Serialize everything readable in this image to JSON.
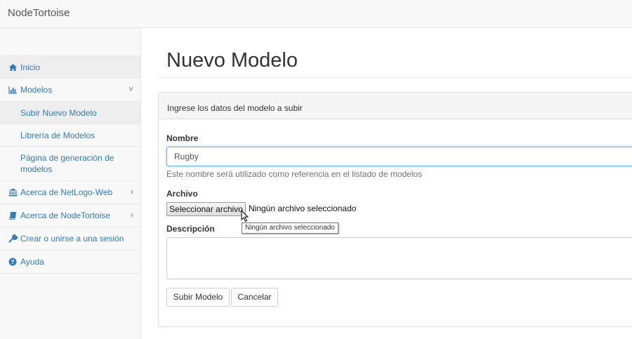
{
  "navbar": {
    "brand": "NodeTortoise"
  },
  "sidebar": {
    "items": [
      {
        "label": "Inicio",
        "icon": "home-icon"
      },
      {
        "label": "Modelos",
        "icon": "bar-chart-icon",
        "arrow": "˅"
      },
      {
        "label": "Subir Nuevo Modelo"
      },
      {
        "label": "Librería de Modelos"
      },
      {
        "label": "Página de generación de modelos"
      },
      {
        "label": "Acerca de NetLogo-Web",
        "icon": "bank-icon",
        "arrow": "‹"
      },
      {
        "label": "Acerca de NodeTortoise",
        "icon": "book-icon",
        "arrow": "‹"
      },
      {
        "label": "Crear o unirse a una sesión",
        "icon": "wrench-icon"
      },
      {
        "label": "Ayuda",
        "icon": "question-circle-icon"
      }
    ]
  },
  "main": {
    "title": "Nuevo Modelo",
    "panel_heading": "Ingrese los datos del modelo a subir",
    "form": {
      "nombre_label": "Nombre",
      "nombre_value": "Rugby",
      "nombre_help": "Este nombre será utilizado como referencia en el listado de modelos",
      "archivo_label": "Archivo",
      "file_button": "Seleccionar archivo",
      "file_status": "Ningún archivo seleccionado",
      "file_tooltip": "Ningún archivo seleccionado",
      "descripcion_label": "Descripción",
      "submit_label": "Subir Modelo",
      "cancel_label": "Cancelar"
    }
  },
  "colors": {
    "link": "#337ab7",
    "focus": "#66afe9"
  }
}
